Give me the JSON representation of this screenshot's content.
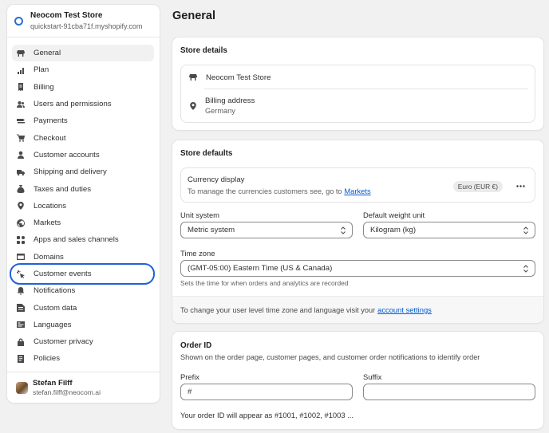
{
  "store": {
    "name": "Neocom Test Store",
    "domain": "quickstart-91cba71f.myshopify.com"
  },
  "nav": {
    "items": [
      {
        "label": "General",
        "icon": "store-icon"
      },
      {
        "label": "Plan",
        "icon": "chart-bars-icon"
      },
      {
        "label": "Billing",
        "icon": "receipt-icon"
      },
      {
        "label": "Users and permissions",
        "icon": "users-icon"
      },
      {
        "label": "Payments",
        "icon": "payments-icon"
      },
      {
        "label": "Checkout",
        "icon": "cart-icon"
      },
      {
        "label": "Customer accounts",
        "icon": "person-icon"
      },
      {
        "label": "Shipping and delivery",
        "icon": "truck-icon"
      },
      {
        "label": "Taxes and duties",
        "icon": "tax-bag-icon"
      },
      {
        "label": "Locations",
        "icon": "location-pin-icon"
      },
      {
        "label": "Markets",
        "icon": "globe-icon"
      },
      {
        "label": "Apps and sales channels",
        "icon": "apps-grid-icon"
      },
      {
        "label": "Domains",
        "icon": "domain-icon"
      },
      {
        "label": "Customer events",
        "icon": "cursor-click-icon"
      },
      {
        "label": "Notifications",
        "icon": "bell-icon"
      },
      {
        "label": "Custom data",
        "icon": "database-icon"
      },
      {
        "label": "Languages",
        "icon": "language-icon"
      },
      {
        "label": "Customer privacy",
        "icon": "lock-icon"
      },
      {
        "label": "Policies",
        "icon": "document-icon"
      }
    ]
  },
  "user": {
    "name": "Stefan Filff",
    "email": "stefan.filff@neocom.ai"
  },
  "page": {
    "title": "General"
  },
  "store_details": {
    "title": "Store details",
    "store_name": "Neocom Test Store",
    "billing_label": "Billing address",
    "billing_value": "Germany"
  },
  "store_defaults": {
    "title": "Store defaults",
    "currency_title": "Currency display",
    "currency_desc": "To manage the currencies customers see, go to",
    "currency_link": "Markets",
    "currency_badge": "Euro (EUR €)",
    "unit_label": "Unit system",
    "unit_value": "Metric system",
    "weight_label": "Default weight unit",
    "weight_value": "Kilogram (kg)",
    "tz_label": "Time zone",
    "tz_value": "(GMT-05:00) Eastern Time (US & Canada)",
    "tz_help": "Sets the time for when orders and analytics are recorded",
    "footer_text": "To change your user level time zone and language visit your",
    "footer_link": "account settings"
  },
  "order_id": {
    "title": "Order ID",
    "desc": "Shown on the order page, customer pages, and customer order notifications to identify order",
    "prefix_label": "Prefix",
    "prefix_value": "#",
    "suffix_label": "Suffix",
    "suffix_value": "",
    "preview": "Your order ID will appear as #1001, #1002, #1003 ..."
  },
  "colors": {
    "accent": "#005bd3",
    "highlight": "#1f62d8"
  }
}
